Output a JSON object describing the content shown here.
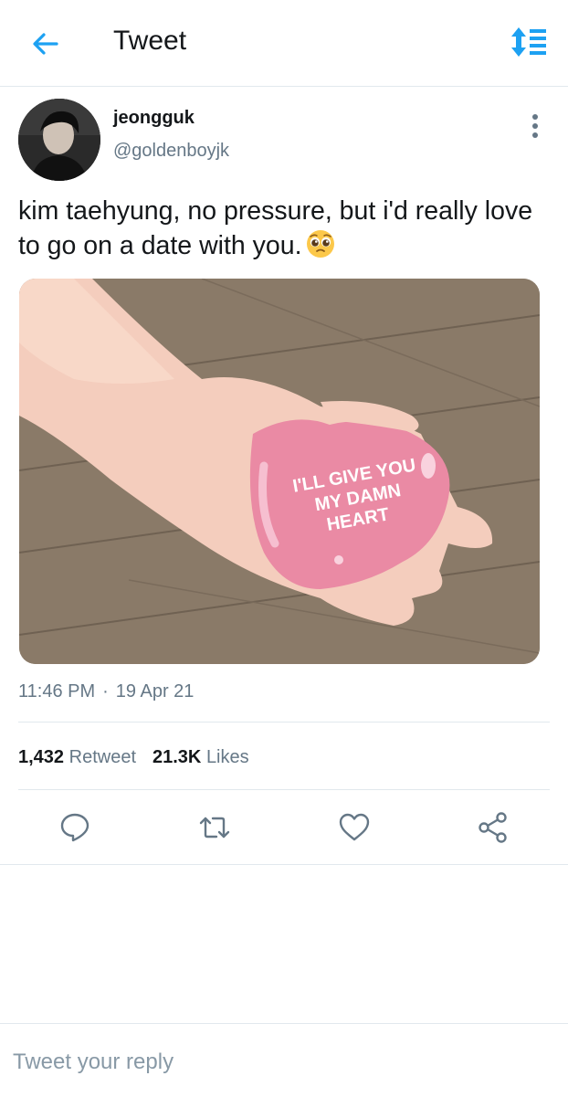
{
  "colors": {
    "accent": "#1da1f2",
    "secondary_text": "#657786",
    "divider": "#e1e8ed"
  },
  "header": {
    "title": "Tweet",
    "back_icon": "arrow-left-icon",
    "sort_icon": "sort-toggle-icon"
  },
  "tweet": {
    "author": {
      "display_name": "jeongguk",
      "handle": "@goldenboyjk",
      "avatar_icon": "avatar"
    },
    "text": "kim taehyung, no pressure, but i'd really love to go on a date with you.",
    "emoji": "pleading-face-emoji",
    "image": {
      "caption_lines": [
        "I'LL GIVE YOU",
        "MY DAMN",
        "HEART"
      ]
    },
    "time": "11:46 PM",
    "separator": "·",
    "date": "19 Apr 21",
    "retweets_count": "1,432",
    "retweets_label": "Retweet",
    "likes_count": "21.3K",
    "likes_label": "Likes"
  },
  "actions": [
    "reply-icon",
    "retweet-icon",
    "like-icon",
    "share-icon"
  ],
  "reply": {
    "placeholder": "Tweet your reply"
  }
}
